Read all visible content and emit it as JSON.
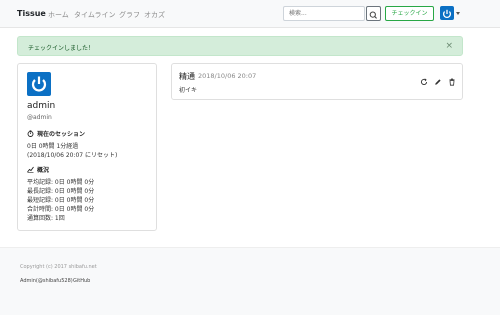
{
  "navbar": {
    "brand": "Tissue",
    "links": [
      "ホーム",
      "タイムライン",
      "グラフ",
      "オカズ"
    ],
    "search_placeholder": "検索...",
    "checkin_label": "チェックイン"
  },
  "alert": {
    "message": "チェックインしました！",
    "close": "×"
  },
  "profile": {
    "display_name": "admin",
    "username": "@admin",
    "session": {
      "heading": "現在のセッション",
      "elapsed": "0日 0時間 1分経過",
      "reset_note": "(2018/10/06 20:07 にリセット)"
    },
    "overview": {
      "heading": "概況",
      "lines": [
        "平均記録: 0日 0時間 0分",
        "最長記録: 0日 0時間 0分",
        "最短記録: 0日 0時間 0分",
        "合計時間: 0日 0時間 0分",
        "通算回数: 1回"
      ]
    }
  },
  "checkin": {
    "title": "精通",
    "date": "2018/10/06 20:07",
    "note": "初イキ"
  },
  "footer": {
    "copyright": "Copyright (c) 2017 shibafu.net",
    "links": [
      "Admin(@shibafu528)",
      "GitHub"
    ]
  },
  "colors": {
    "brand_blue": "#0b70c4",
    "success_green": "#28a745",
    "alert_bg": "#d4edda"
  }
}
